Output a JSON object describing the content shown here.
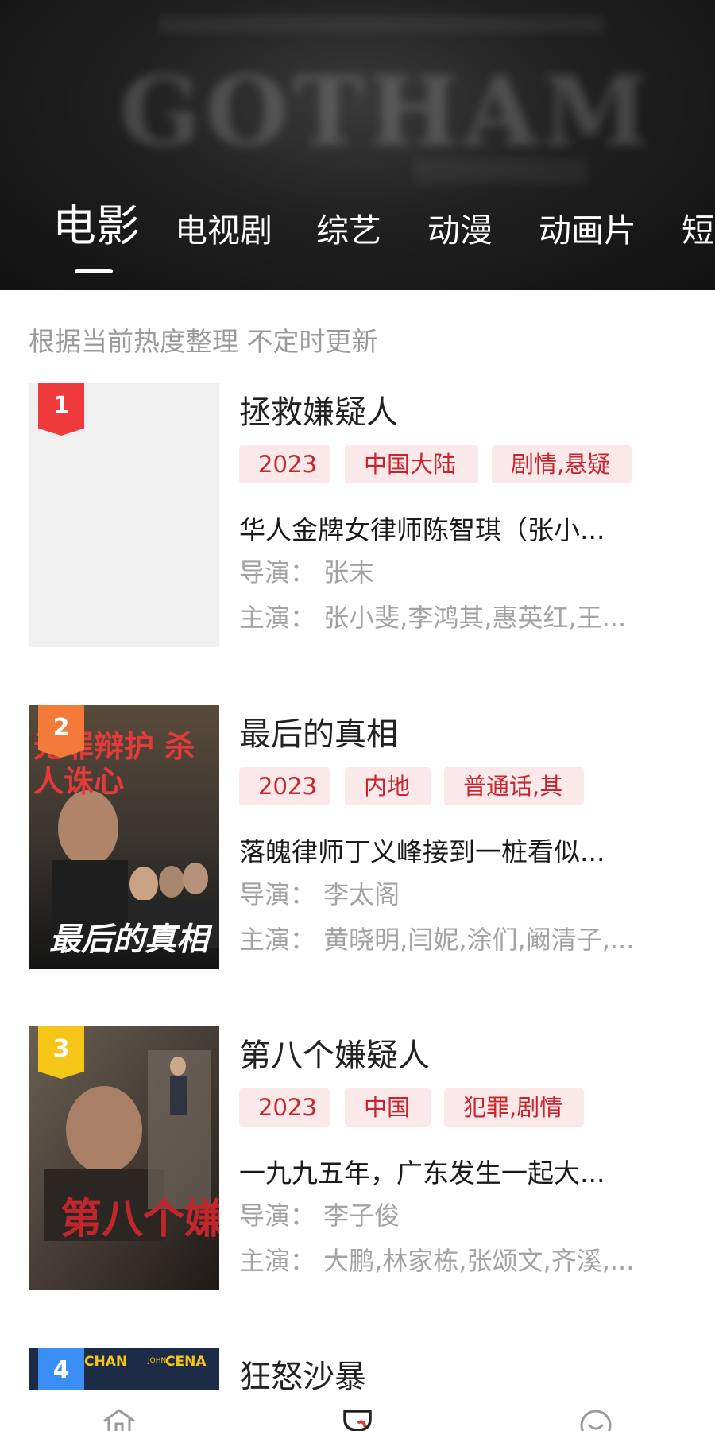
{
  "header": {
    "backdrop_text": "GOTHAM",
    "tabs": [
      {
        "label": "电影",
        "active": true
      },
      {
        "label": "电视剧",
        "active": false
      },
      {
        "label": "综艺",
        "active": false
      },
      {
        "label": "动漫",
        "active": false
      },
      {
        "label": "动画片",
        "active": false
      },
      {
        "label": "短",
        "active": false
      }
    ]
  },
  "subtitle": "根据当前热度整理 不定时更新",
  "colors": {
    "rank1": "#ef3b3b",
    "rank2": "#f47a3a",
    "rank3": "#f5c518",
    "rank4": "#3a8ef5",
    "tag_bg": "#fbe9ea",
    "tag_text": "#c8252f"
  },
  "movies": [
    {
      "rank": "1",
      "title": "拯救嫌疑人",
      "tags": [
        "2023",
        "中国大陆",
        "剧情,悬疑"
      ],
      "desc": "华人金牌女律师陈智琪（张小...",
      "director": "导演：  张末",
      "cast": "主演：  张小斐,李鸿其,惠英红,王..."
    },
    {
      "rank": "2",
      "title": "最后的真相",
      "tags": [
        "2023",
        "内地",
        "普通话,其"
      ],
      "desc": "落魄律师丁义峰接到一桩看似...",
      "director": "导演：  李太阁",
      "cast": "主演：  黄晓明,闫妮,涂们,阚清子,...",
      "poster_text_top": "无罪辩护 杀人诛心",
      "poster_text_bottom": "最后的真相"
    },
    {
      "rank": "3",
      "title": "第八个嫌疑人",
      "tags": [
        "2023",
        "中国",
        "犯罪,剧情"
      ],
      "desc": "一九九五年，广东发生一起大...",
      "director": "导演：  李子俊",
      "cast": "主演：  大鹏,林家栋,张颂文,齐溪,...",
      "poster_text": "第八个嫌"
    },
    {
      "rank": "4",
      "title": "狂怒沙暴",
      "poster_text_left": "CHAN",
      "poster_text_mid": "JOHN",
      "poster_text_right": "CENA"
    }
  ],
  "bottom_nav": {
    "icons": [
      "home-icon",
      "discover-icon",
      "profile-icon"
    ]
  }
}
